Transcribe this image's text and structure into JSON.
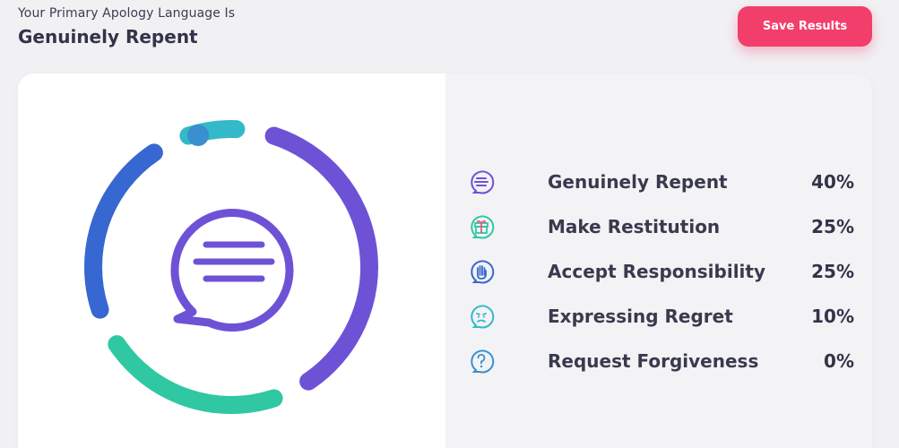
{
  "header": {
    "eyebrow": "Your Primary Apology Language Is",
    "title": "Genuinely Repent",
    "save_label": "Save Results"
  },
  "colors": {
    "accent": "#f23e6a",
    "purple": "#6e52d6",
    "teal": "#2fc8a2",
    "blue": "#3767d0",
    "cyan": "#33b9c9",
    "dot": "#3a8fcf"
  },
  "chart_data": {
    "type": "pie",
    "categories": [
      "Genuinely Repent",
      "Make Restitution",
      "Accept Responsibility",
      "Expressing Regret",
      "Request Forgiveness"
    ],
    "values": [
      40,
      25,
      25,
      10,
      0
    ]
  },
  "results": [
    {
      "icon": "speech-bubble-icon",
      "label": "Genuinely Repent",
      "value": "40%"
    },
    {
      "icon": "gift-icon",
      "label": "Make Restitution",
      "value": "25%"
    },
    {
      "icon": "raised-hand-icon",
      "label": "Accept Responsibility",
      "value": "25%"
    },
    {
      "icon": "sad-face-icon",
      "label": "Expressing Regret",
      "value": "10%"
    },
    {
      "icon": "question-icon",
      "label": "Request Forgiveness",
      "value": "0%"
    }
  ]
}
